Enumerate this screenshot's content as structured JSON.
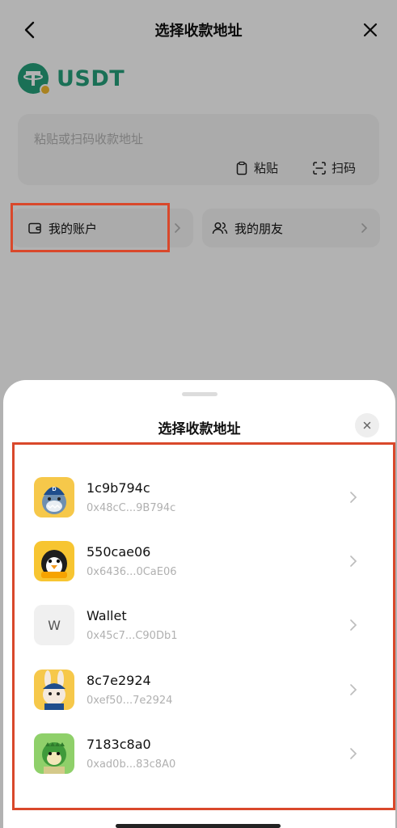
{
  "header": {
    "title": "选择收款地址",
    "back_icon": "back-arrow-icon",
    "close_icon": "close-icon"
  },
  "coin": {
    "name": "USDT",
    "color": "#26a17b"
  },
  "address_input": {
    "placeholder": "粘贴或扫码收款地址",
    "paste_label": "粘贴",
    "scan_label": "扫码"
  },
  "tiles": {
    "accounts_label": "我的账户",
    "friends_label": "我的朋友"
  },
  "sheet": {
    "title": "选择收款地址",
    "wallets": [
      {
        "name": "1c9b794c",
        "address": "0x48cC...9B794c",
        "avatar": "shark-avatar"
      },
      {
        "name": "550cae06",
        "address": "0x6436...0CaE06",
        "avatar": "penguin-avatar"
      },
      {
        "name": "Wallet",
        "address": "0x45c7...C90Db1",
        "avatar": "letter-avatar",
        "letter": "W"
      },
      {
        "name": "8c7e2924",
        "address": "0xef50...7e2924",
        "avatar": "rabbit-avatar"
      },
      {
        "name": "7183c8a0",
        "address": "0xad0b...83c8A0",
        "avatar": "dino-avatar"
      }
    ]
  },
  "colors": {
    "highlight": "#d9482b",
    "accent": "#26a17b"
  }
}
